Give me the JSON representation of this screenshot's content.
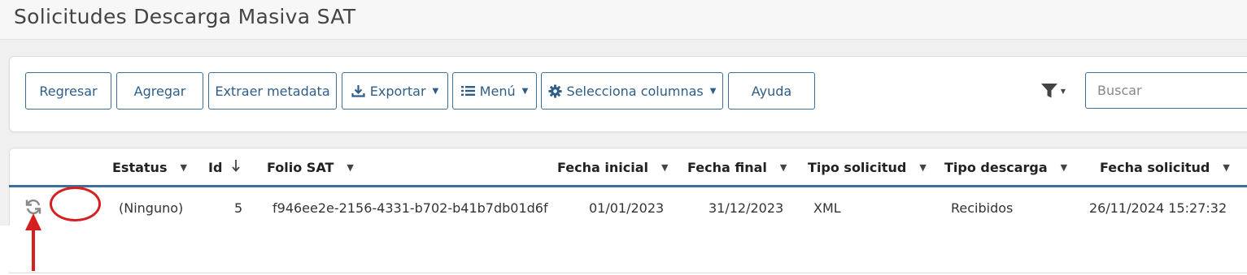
{
  "page": {
    "title": "Solicitudes Descarga Masiva SAT"
  },
  "toolbar": {
    "regresar": "Regresar",
    "agregar": "Agregar",
    "extraer": "Extraer metadata",
    "exportar": "Exportar",
    "menu": "Menú",
    "columnas": "Selecciona columnas",
    "ayuda": "Ayuda",
    "search_placeholder": "Buscar",
    "search_value": ""
  },
  "table": {
    "headers": {
      "estatus": "Estatus",
      "id": "Id",
      "folio": "Folio SAT",
      "fecha_inicial": "Fecha inicial",
      "fecha_final": "Fecha final",
      "tipo_solicitud": "Tipo solicitud",
      "tipo_descarga": "Tipo descarga",
      "fecha_solicitud": "Fecha solicitud"
    },
    "rows": [
      {
        "estatus": "(Ninguno)",
        "id": "5",
        "folio": "f946ee2e-2156-4331-b702-b41b7db01d6f",
        "fecha_inicial": "01/01/2023",
        "fecha_final": "31/12/2023",
        "tipo_solicitud": "XML",
        "tipo_descarga": "Recibidos",
        "fecha_solicitud": "26/11/2024 15:27:32"
      }
    ]
  },
  "icons": {
    "export": "download-icon",
    "menu": "list-icon",
    "columns": "gear-icon",
    "filter": "filter-icon",
    "row_action": "refresh-icon",
    "id_sort": "arrow-down-icon"
  },
  "colors": {
    "accent": "#3d6f99",
    "button_text": "#2e5d86",
    "annotation": "#d62020"
  }
}
